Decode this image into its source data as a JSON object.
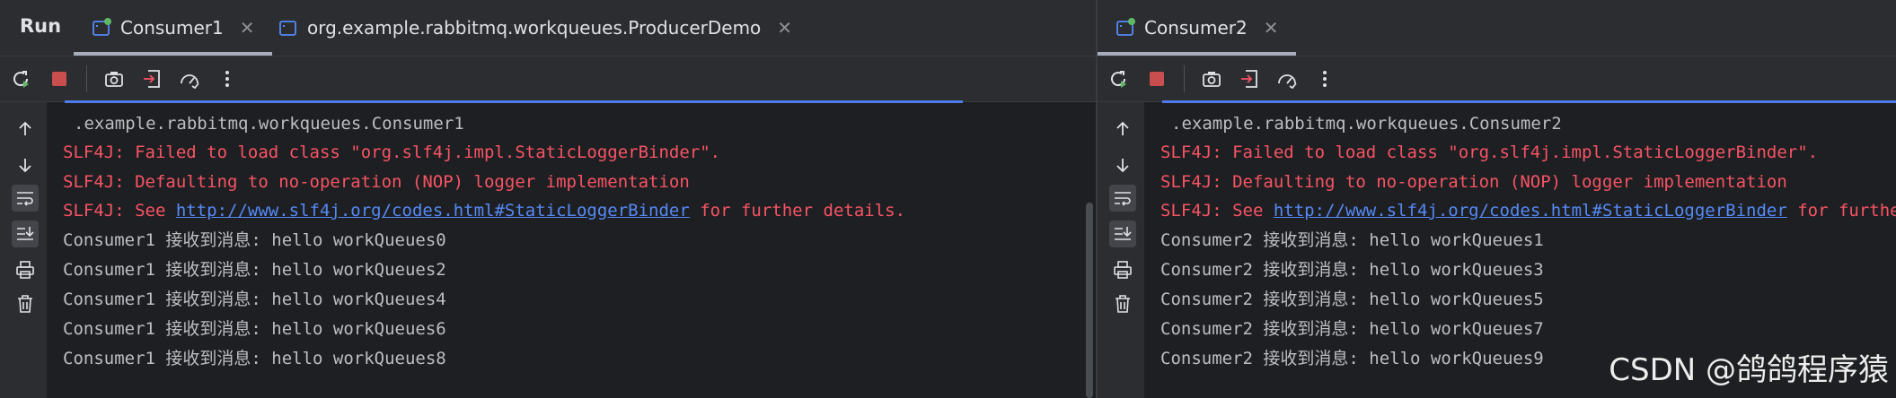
{
  "left_pane": {
    "run_title": "Run",
    "tabs": [
      {
        "label": "Consumer1",
        "active": true
      },
      {
        "label": "org.example.rabbitmq.workqueues.ProducerDemo",
        "active": false
      }
    ],
    "console": {
      "class_line": ".example.rabbitmq.workqueues.Consumer1",
      "slf4j_1": "SLF4J: Failed to load class \"org.slf4j.impl.StaticLoggerBinder\".",
      "slf4j_2": "SLF4J: Defaulting to no-operation (NOP) logger implementation",
      "slf4j_3_prefix": "SLF4J: See ",
      "slf4j_3_link": "http://www.slf4j.org/codes.html#StaticLoggerBinder",
      "slf4j_3_suffix": " for further details.",
      "messages": [
        "Consumer1 接收到消息: hello workQueues0",
        "Consumer1 接收到消息: hello workQueues2",
        "Consumer1 接收到消息: hello workQueues4",
        "Consumer1 接收到消息: hello workQueues6",
        "Consumer1 接收到消息: hello workQueues8"
      ]
    }
  },
  "right_pane": {
    "tabs": [
      {
        "label": "Consumer2",
        "active": true
      }
    ],
    "console": {
      "class_line": ".example.rabbitmq.workqueues.Consumer2",
      "slf4j_1": "SLF4J: Failed to load class \"org.slf4j.impl.StaticLoggerBinder\".",
      "slf4j_2": "SLF4J: Defaulting to no-operation (NOP) logger implementation",
      "slf4j_3_prefix": "SLF4J: See ",
      "slf4j_3_link": "http://www.slf4j.org/codes.html#StaticLoggerBinder",
      "slf4j_3_suffix": " for further details.",
      "messages": [
        "Consumer2 接收到消息: hello workQueues1",
        "Consumer2 接收到消息: hello workQueues3",
        "Consumer2 接收到消息: hello workQueues5",
        "Consumer2 接收到消息: hello workQueues7",
        "Consumer2 接收到消息: hello workQueues9"
      ]
    }
  },
  "icons": {
    "tab": "console-tab-icon",
    "toolbar": [
      "rerun-icon",
      "stop-icon",
      "screenshot-icon",
      "restore-layout-icon",
      "profiler-icon",
      "more-icon"
    ],
    "gutter": [
      "scroll-up-icon",
      "scroll-down-icon",
      "soft-wrap-icon",
      "scroll-to-end-icon",
      "print-icon",
      "clear-icon"
    ]
  },
  "colors": {
    "background": "#1e1f22",
    "panel": "#2b2d30",
    "error_text": "#f75464",
    "normal_text": "#bcbec4",
    "link": "#548af7",
    "tab_icon_badge": "#5fb865",
    "stop": "#c94f4f"
  },
  "watermark": "CSDN @鸽鸽程序猿"
}
